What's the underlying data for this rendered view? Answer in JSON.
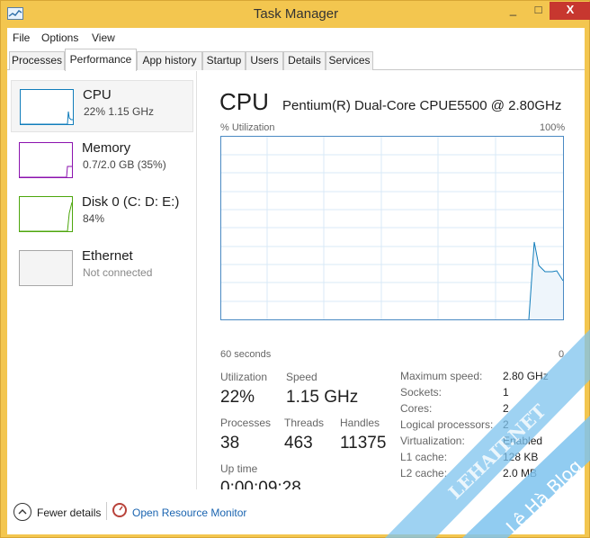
{
  "window": {
    "title": "Task Manager",
    "minimize": "_",
    "maximize": "□",
    "close": "X"
  },
  "menu": [
    "File",
    "Options",
    "View"
  ],
  "tabs": [
    "Processes",
    "Performance",
    "App history",
    "Startup",
    "Users",
    "Details",
    "Services"
  ],
  "resources": [
    {
      "title": "CPU",
      "sub": "22%  1.15 GHz",
      "color": "#117dbb"
    },
    {
      "title": "Memory",
      "sub": "0.7/2.0 GB (35%)",
      "color": "#8b12ae"
    },
    {
      "title": "Disk 0 (C: D: E:)",
      "sub": "84%",
      "color": "#4da60c"
    },
    {
      "title": "Ethernet",
      "sub": "Not connected",
      "color": "#a7a7a7"
    }
  ],
  "cpu": {
    "title": "CPU",
    "model": "Pentium(R) Dual-Core CPUE5500 @ 2.80GHz",
    "util_label": "% Utilization",
    "max_label": "100%",
    "time_label": "60 seconds",
    "zero_label": "0",
    "graph_color": "#117dbb"
  },
  "stats": {
    "utilization_label": "Utilization",
    "utilization": "22%",
    "speed_label": "Speed",
    "speed": "1.15 GHz",
    "processes_label": "Processes",
    "processes": "38",
    "threads_label": "Threads",
    "threads": "463",
    "handles_label": "Handles",
    "handles": "11375",
    "uptime_label": "Up time",
    "uptime": "0:00:09:28"
  },
  "details": [
    {
      "key": "Maximum speed:",
      "value": "2.80 GHz"
    },
    {
      "key": "Sockets:",
      "value": "1"
    },
    {
      "key": "Cores:",
      "value": "2"
    },
    {
      "key": "Logical processors:",
      "value": "2"
    },
    {
      "key": "Virtualization:",
      "value": "Enabled"
    },
    {
      "key": "L1 cache:",
      "value": "128 KB"
    },
    {
      "key": "L2 cache:",
      "value": "2.0 MB"
    }
  ],
  "footer": {
    "fewer": "Fewer details",
    "resource_monitor": "Open Resource Monitor"
  },
  "watermark": {
    "line1": "LEHAIT.NET",
    "line2": "Lê Hà Blog"
  }
}
